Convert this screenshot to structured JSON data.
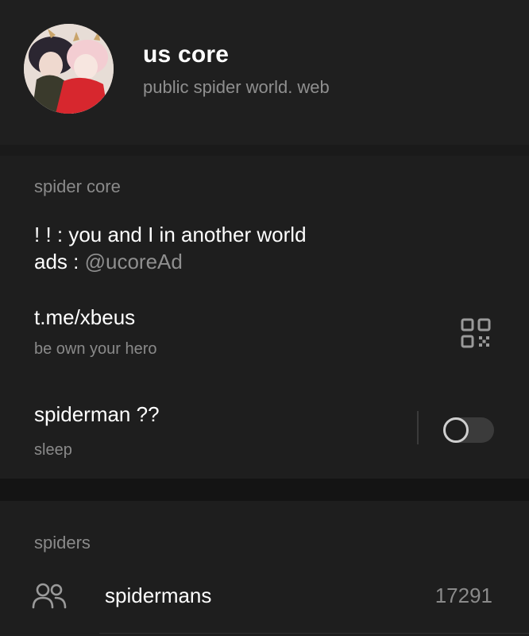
{
  "channel": {
    "title": "us core",
    "subtitle": "public spider world. web"
  },
  "info": {
    "section_label": "spider core",
    "bio_line1": "! !  : you and I in another world",
    "bio_ads_prefix": "ads : ",
    "bio_ads_handle": "@ucoreAd",
    "link": "t.me/xbeus",
    "link_sub": "be own your hero",
    "toggle_title": "spiderman ??",
    "toggle_sub": "sleep",
    "toggle_on": false
  },
  "members": {
    "section_label": "spiders",
    "row_label": "spidermans",
    "row_count": "17291"
  },
  "icons": {
    "qr": "qr-code-icon",
    "members": "people-icon"
  },
  "colors": {
    "background": "#1a1a1a",
    "panel": "#1e1e1e",
    "muted_text": "#8a8a8a",
    "primary_text": "#ffffff"
  }
}
